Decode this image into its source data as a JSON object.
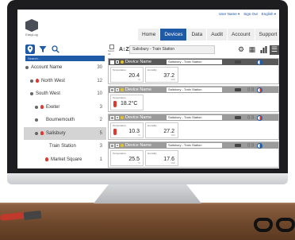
{
  "header": {
    "user_link": "User Name ▾",
    "signout_link": "Sign Out",
    "lang_link": "English ▾",
    "logo_text": "EasyLog"
  },
  "nav": [
    "Home",
    "Devices",
    "Data",
    "Audit",
    "Account",
    "Support"
  ],
  "nav_active": "Devices",
  "sidebar": {
    "search_placeholder": "Search...",
    "items": [
      {
        "label": "Account Name",
        "count": "30",
        "indent": 0,
        "icon": "dot"
      },
      {
        "label": "North West",
        "count": "12",
        "indent": 1,
        "icon": "dot-alert"
      },
      {
        "label": "South West",
        "count": "10",
        "indent": 1,
        "icon": "dot"
      },
      {
        "label": "Exeter",
        "count": "3",
        "indent": 2,
        "icon": "dot-alert"
      },
      {
        "label": "Bournemouth",
        "count": "2",
        "indent": 2,
        "icon": "dot"
      },
      {
        "label": "Salisbury",
        "count": "5",
        "indent": 2,
        "icon": "dot-alert",
        "selected": true
      },
      {
        "label": "Train Station",
        "count": "3",
        "indent": 3,
        "icon": "none"
      },
      {
        "label": "Market Square",
        "count": "1",
        "indent": 3,
        "icon": "alert"
      }
    ]
  },
  "main": {
    "select_all_label": "Select All",
    "sort_label": "A↕Z",
    "breadcrumb": "Salisbury - Train Station",
    "cards": [
      {
        "name": "Device Name",
        "location": "Salisbury - Train Station",
        "checked": true,
        "dark": true,
        "pie": "blue",
        "readings": [
          {
            "label": "Temperature",
            "value": "20.4",
            "unit": "°C"
          },
          {
            "label": "Humidity",
            "value": "37.2",
            "unit": "%rh"
          }
        ]
      },
      {
        "name": "Device Name",
        "location": "Salisbury - Train Station",
        "checked": false,
        "dark": false,
        "pie": "red",
        "readings": [
          {
            "label": "Temperature",
            "value": "18.2°C",
            "unit": ""
          }
        ]
      },
      {
        "name": "Device Name",
        "location": "Salisbury - Train Station",
        "checked": false,
        "dark": false,
        "pie": "red",
        "readings": [
          {
            "label": "Temperature",
            "value": "10.3",
            "unit": "°C"
          },
          {
            "label": "Humidity",
            "value": "27.2",
            "unit": "%rh"
          }
        ]
      },
      {
        "name": "Device Name",
        "location": "Salisbury - Train Station",
        "checked": false,
        "dark": false,
        "pie": "blue",
        "readings": [
          {
            "label": "Temperature",
            "value": "25.5",
            "unit": "°C"
          },
          {
            "label": "Humidity",
            "value": "17.6",
            "unit": "%rh"
          }
        ]
      }
    ]
  },
  "colors": {
    "accent": "#1f5aa6",
    "alert": "#e0382c",
    "status_yellow": "#e8c31c"
  }
}
